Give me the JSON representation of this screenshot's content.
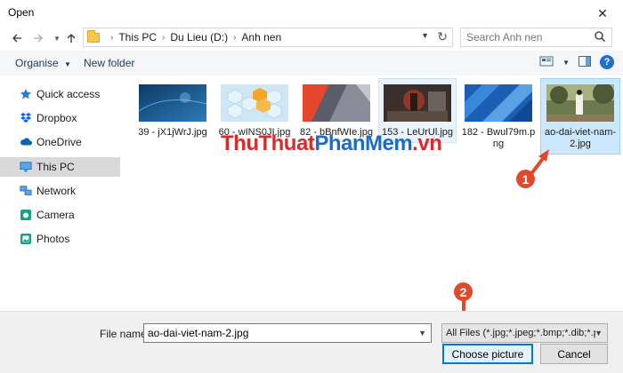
{
  "window": {
    "title": "Open"
  },
  "address": {
    "crumbs": [
      "This PC",
      "Du Lieu (D:)",
      "Anh nen"
    ]
  },
  "search": {
    "placeholder": "Search Anh nen"
  },
  "toolbar": {
    "organise": "Organise",
    "new_folder": "New folder"
  },
  "sidebar": {
    "items": [
      {
        "label": "Quick access",
        "icon": "star-icon"
      },
      {
        "label": "Dropbox",
        "icon": "dropbox-icon"
      },
      {
        "label": "OneDrive",
        "icon": "cloud-icon"
      },
      {
        "label": "This PC",
        "icon": "monitor-icon",
        "active": true
      },
      {
        "label": "Network",
        "icon": "network-icon"
      },
      {
        "label": "Camera",
        "icon": "camera-icon"
      },
      {
        "label": "Photos",
        "icon": "photos-icon"
      }
    ]
  },
  "files": [
    {
      "name": "39 - jX1jWrJ.jpg"
    },
    {
      "name": "60 - wINS0JI.jpg"
    },
    {
      "name": "82 - bBnfWIe.jpg"
    },
    {
      "name": "153 - LeUrUl.jpg"
    },
    {
      "name": "182 - Bwul79m.png"
    },
    {
      "name": "ao-dai-viet-nam-2.jpg",
      "selected": true
    }
  ],
  "watermark": {
    "part1": "ThuThuat",
    "part2": "PhanMem",
    "part3": ".vn"
  },
  "markers": {
    "one": "1",
    "two": "2"
  },
  "bottom": {
    "file_name_label": "File name:",
    "file_name_value": "ao-dai-viet-nam-2.jpg",
    "filter": "All Files (*.jpg;*.jpeg;*.bmp;*.dib;*.png",
    "choose_button": "Choose picture",
    "cancel_button": "Cancel"
  },
  "colors": {
    "accent": "#0078d7",
    "selection": "#cce8ff",
    "marker": "#e04a2c"
  }
}
